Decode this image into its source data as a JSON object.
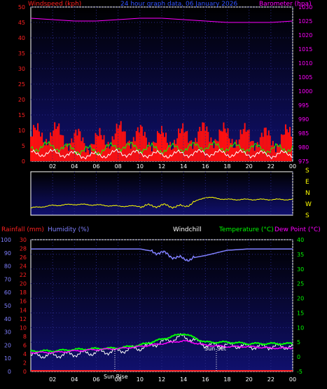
{
  "header": {
    "windspeed_label": "Windspeed (kph)",
    "title": "24 hour graph data, 06 January 2026",
    "barometer_label": "Barometer (hpa)"
  },
  "lower_header": {
    "rainfall_label": "Rainfall (mm)",
    "humidity_label": "Humidity (%)",
    "windchill_label": "Windchill",
    "temperature_label": "Temperature (°C)",
    "dewpoint_label": "Dew Point (°C)"
  },
  "compass_letters": [
    "S",
    "E",
    "N",
    "W",
    "S"
  ],
  "markers": {
    "sunrise": "Sun Rise",
    "sunset": "Sun Set"
  },
  "colors": {
    "wind": "#ff1010",
    "gust": "#00ff00",
    "avg": "#ffffff",
    "barometer": "#ff00ff",
    "direction": "#ffff00",
    "humidity": "#8080ff",
    "temperature": "#00ff00",
    "dewpoint": "#ff00ff",
    "windchill": "#ffffff",
    "rainfall": "#ff2020",
    "left_axis": "#ff2020",
    "right_axis_top": "#ff00ff",
    "right_axis_bottom": "#00ff00"
  },
  "chart_data": [
    {
      "type": "line",
      "title": "24 hour graph data, 06 January 2026",
      "x": [
        0,
        2,
        4,
        6,
        8,
        10,
        12,
        14,
        16,
        18,
        20,
        22,
        24
      ],
      "x_tick_labels": [
        "02",
        "04",
        "06",
        "08",
        "10",
        "12",
        "14",
        "16",
        "18",
        "20",
        "22",
        "00"
      ],
      "y_left_label": "Windspeed (kph)",
      "y_left_ticks": [
        0,
        5,
        10,
        15,
        20,
        25,
        30,
        35,
        40,
        45,
        50
      ],
      "ylim_left": [
        0,
        50
      ],
      "y_right_label": "Barometer (hpa)",
      "y_right_ticks": [
        975,
        980,
        985,
        990,
        995,
        1000,
        1005,
        1010,
        1015,
        1020,
        1025,
        1030
      ],
      "ylim_right": [
        975,
        1030
      ],
      "series": [
        {
          "name": "Windspeed (kph)",
          "axis": "left",
          "values": [
            8,
            9,
            7,
            6,
            9,
            8,
            7,
            8,
            9,
            8,
            8,
            7,
            8
          ]
        },
        {
          "name": "Barometer (hpa)",
          "axis": "right",
          "values": [
            1026,
            1025.5,
            1025,
            1025,
            1025.5,
            1026,
            1026,
            1025.5,
            1025,
            1024.5,
            1024.5,
            1024.5,
            1025
          ]
        }
      ]
    },
    {
      "type": "line",
      "x": [
        0,
        2,
        4,
        6,
        8,
        10,
        12,
        14,
        16,
        18,
        20,
        22,
        24
      ],
      "ylim": [
        0,
        360
      ],
      "series": [
        {
          "name": "Wind direction",
          "values": [
            60,
            80,
            90,
            85,
            75,
            75,
            80,
            70,
            150,
            130,
            130,
            130,
            130
          ]
        }
      ]
    },
    {
      "type": "line",
      "x": [
        0,
        2,
        4,
        6,
        8,
        10,
        12,
        14,
        16,
        18,
        20,
        22,
        24
      ],
      "x_tick_labels": [
        "02",
        "04",
        "06",
        "08",
        "10",
        "12",
        "14",
        "16",
        "18",
        "20",
        "22",
        "00"
      ],
      "y_left_ticks_humidity": [
        0,
        10,
        20,
        30,
        40,
        50,
        60,
        70,
        80,
        90,
        100
      ],
      "y_left_ticks_rainfall": [
        0,
        2,
        4,
        6,
        8,
        10,
        12,
        14,
        16,
        18,
        20,
        22,
        24,
        26,
        28,
        30
      ],
      "y_right_ticks": [
        -5,
        0,
        5,
        10,
        15,
        20,
        25,
        30,
        35,
        40
      ],
      "ylim_humidity": [
        0,
        100
      ],
      "ylim_rainfall": [
        0,
        30
      ],
      "ylim_temperature": [
        -5,
        40
      ],
      "series": [
        {
          "name": "Humidity (%)",
          "axis": "humidity",
          "values": [
            93,
            93,
            93,
            93,
            93,
            93,
            90,
            85,
            88,
            92,
            93,
            93,
            93
          ]
        },
        {
          "name": "Temperature (°C)",
          "axis": "temperature",
          "values": [
            2,
            2,
            2.5,
            2.8,
            3,
            4,
            6,
            8,
            5,
            5,
            4.5,
            4.5,
            4.5
          ]
        },
        {
          "name": "Dew Point (°C)",
          "axis": "temperature",
          "values": [
            1.5,
            1.5,
            2,
            2.5,
            2.8,
            3.5,
            4.5,
            5.5,
            4,
            3.5,
            3.5,
            3,
            3
          ]
        },
        {
          "name": "Windchill",
          "axis": "temperature",
          "values": [
            0.5,
            0.5,
            1,
            1.5,
            2,
            3,
            5,
            7,
            4,
            4,
            3.5,
            3.5,
            3.5
          ]
        },
        {
          "name": "Rainfall (mm)",
          "axis": "rainfall",
          "values": [
            0,
            0,
            0,
            0,
            0,
            0,
            0,
            0,
            0,
            0,
            0,
            0,
            0
          ]
        }
      ]
    }
  ]
}
